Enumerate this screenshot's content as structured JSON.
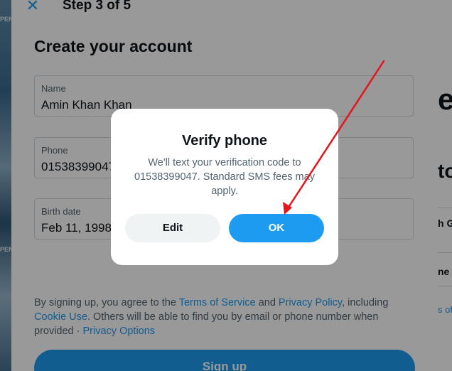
{
  "background": {
    "strip_text_top": "PEN",
    "strip_text_bottom": "PEN",
    "right_heading_1": "e",
    "right_heading_2": "to",
    "right_item_1": "h G",
    "right_item_2": "ne",
    "right_link": "s of"
  },
  "signup": {
    "step": "Step 3 of 5",
    "title": "Create your account",
    "fields": {
      "name": {
        "label": "Name",
        "value": "Amin Khan Khan"
      },
      "phone": {
        "label": "Phone",
        "value": "01538399047"
      },
      "birth_date": {
        "label": "Birth date",
        "value": "Feb 11, 1998"
      }
    },
    "terms": {
      "prefix": "By signing up, you agree to the ",
      "tos": "Terms of Service",
      "and": " and ",
      "privacy": "Privacy Policy",
      "including": ", including ",
      "cookie": "Cookie Use",
      "rest": ". Others will be able to find you by email or phone number when provided · ",
      "privacy_options": "Privacy Options"
    },
    "signup_button": "Sign up"
  },
  "dialog": {
    "title": "Verify phone",
    "body": "We'll text your verification code to 01538399047. Standard SMS fees may apply.",
    "edit_button": "Edit",
    "ok_button": "OK"
  },
  "icons": {
    "close": "close-icon",
    "arrow": "red-annotation-arrow"
  },
  "colors": {
    "accent": "#1d9bf0",
    "annotation": "#e8141b"
  }
}
